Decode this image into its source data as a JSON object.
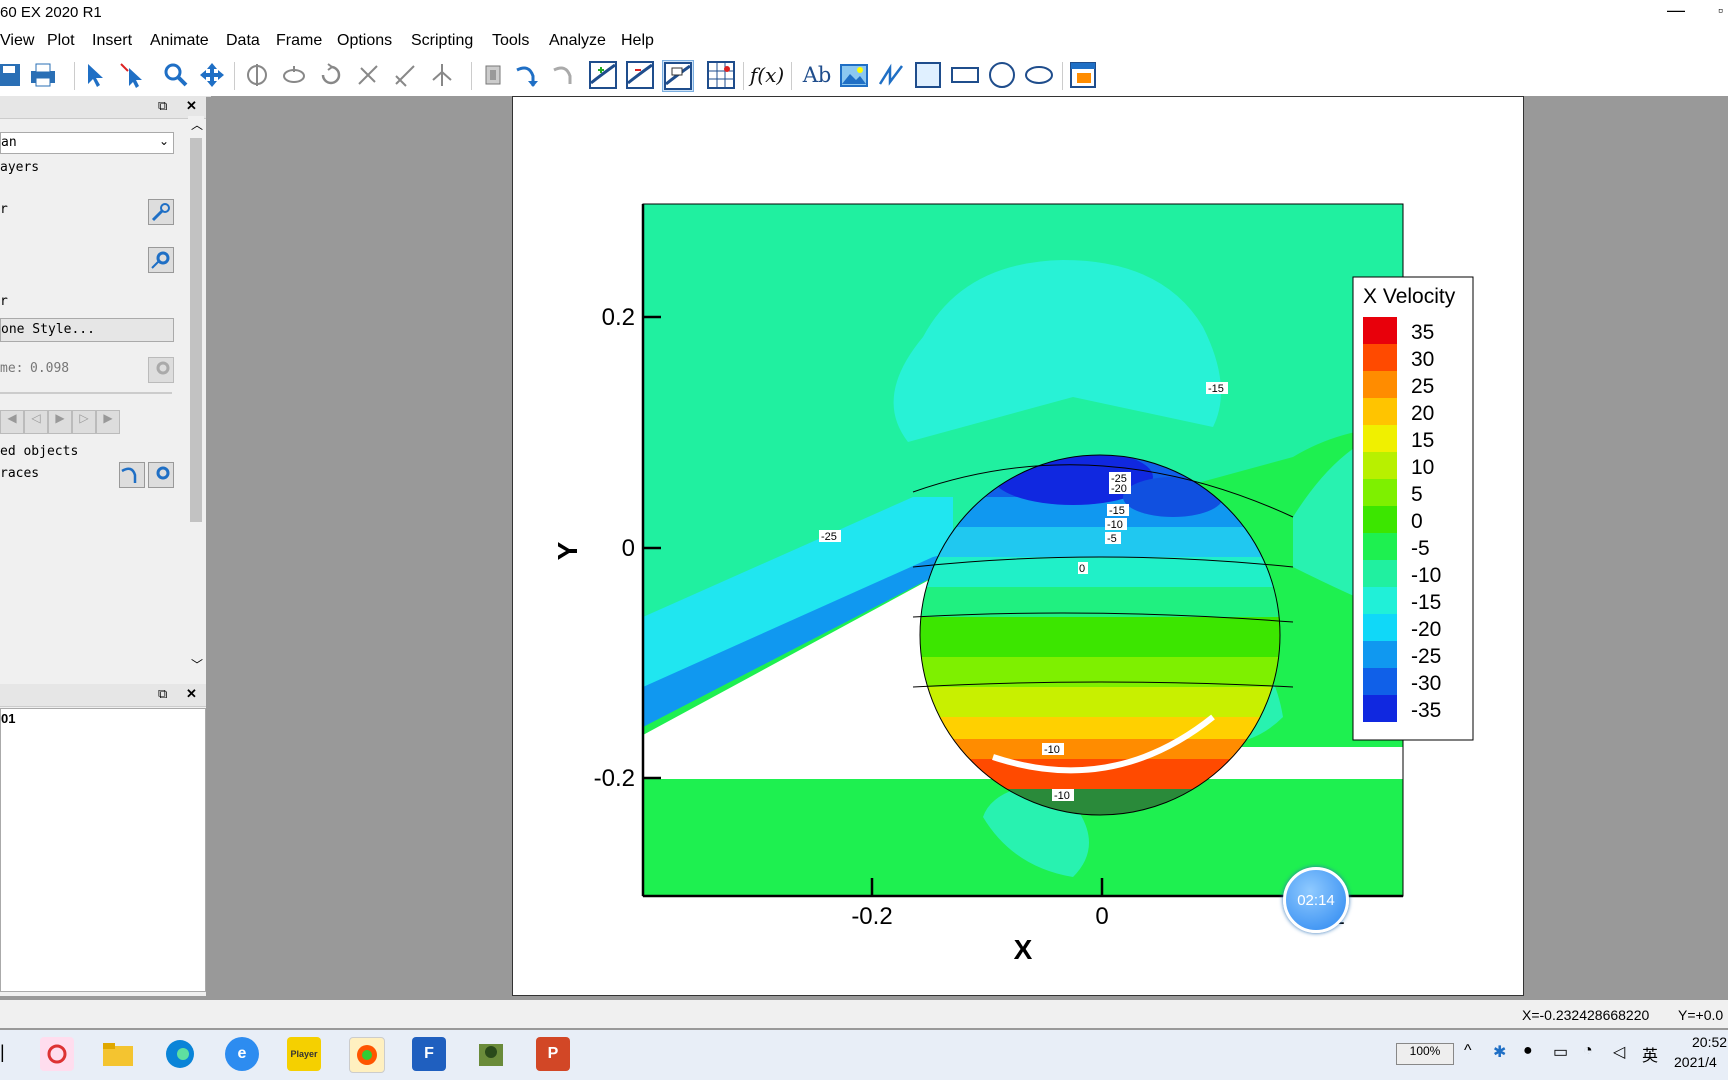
{
  "window": {
    "title": "60 EX 2020 R1"
  },
  "menu": [
    "View",
    "Plot",
    "Insert",
    "Animate",
    "Data",
    "Frame",
    "Options",
    "Scripting",
    "Tools",
    "Analyze",
    "Help"
  ],
  "left_panel": {
    "dropdown_value": "an",
    "layers_label": "ayers",
    "item_r1": "r",
    "item_r2": "r",
    "zone_style_button": "one Style...",
    "time_label": "me:",
    "time_value": "0.098",
    "objects_label": "ed objects",
    "traces_label": "races",
    "frame_item": "01"
  },
  "plot": {
    "legend_title": "X Velocity",
    "legend_levels": [
      "35",
      "30",
      "25",
      "20",
      "15",
      "10",
      "5",
      "0",
      "-5",
      "-10",
      "-15",
      "-20",
      "-25",
      "-30",
      "-35"
    ],
    "legend_colors": [
      "#e8000b",
      "#ff4a00",
      "#ff8c00",
      "#ffc400",
      "#f0f000",
      "#b8f000",
      "#7ef000",
      "#3ce600",
      "#1ef050",
      "#20f0a0",
      "#20f0d8",
      "#10d8f8",
      "#1098f0",
      "#1060e8",
      "#1028e0"
    ],
    "y_ticks": [
      "0.2",
      "0",
      "-0.2"
    ],
    "x_ticks": [
      "-0.2",
      "0",
      ".2"
    ],
    "x_label": "X",
    "y_label": "Y",
    "contour_labels": [
      "-15",
      "-25",
      "-20",
      "-15",
      "-10",
      "-5",
      "0",
      "-25",
      "-10",
      "-10"
    ]
  },
  "timer": "02:14",
  "status": {
    "x_readout": "X=-0.232428668220",
    "y_readout": "Y=+0.0"
  },
  "tray": {
    "battery": "100%",
    "ime": "英",
    "time": "20:52",
    "date": "2021/4"
  }
}
